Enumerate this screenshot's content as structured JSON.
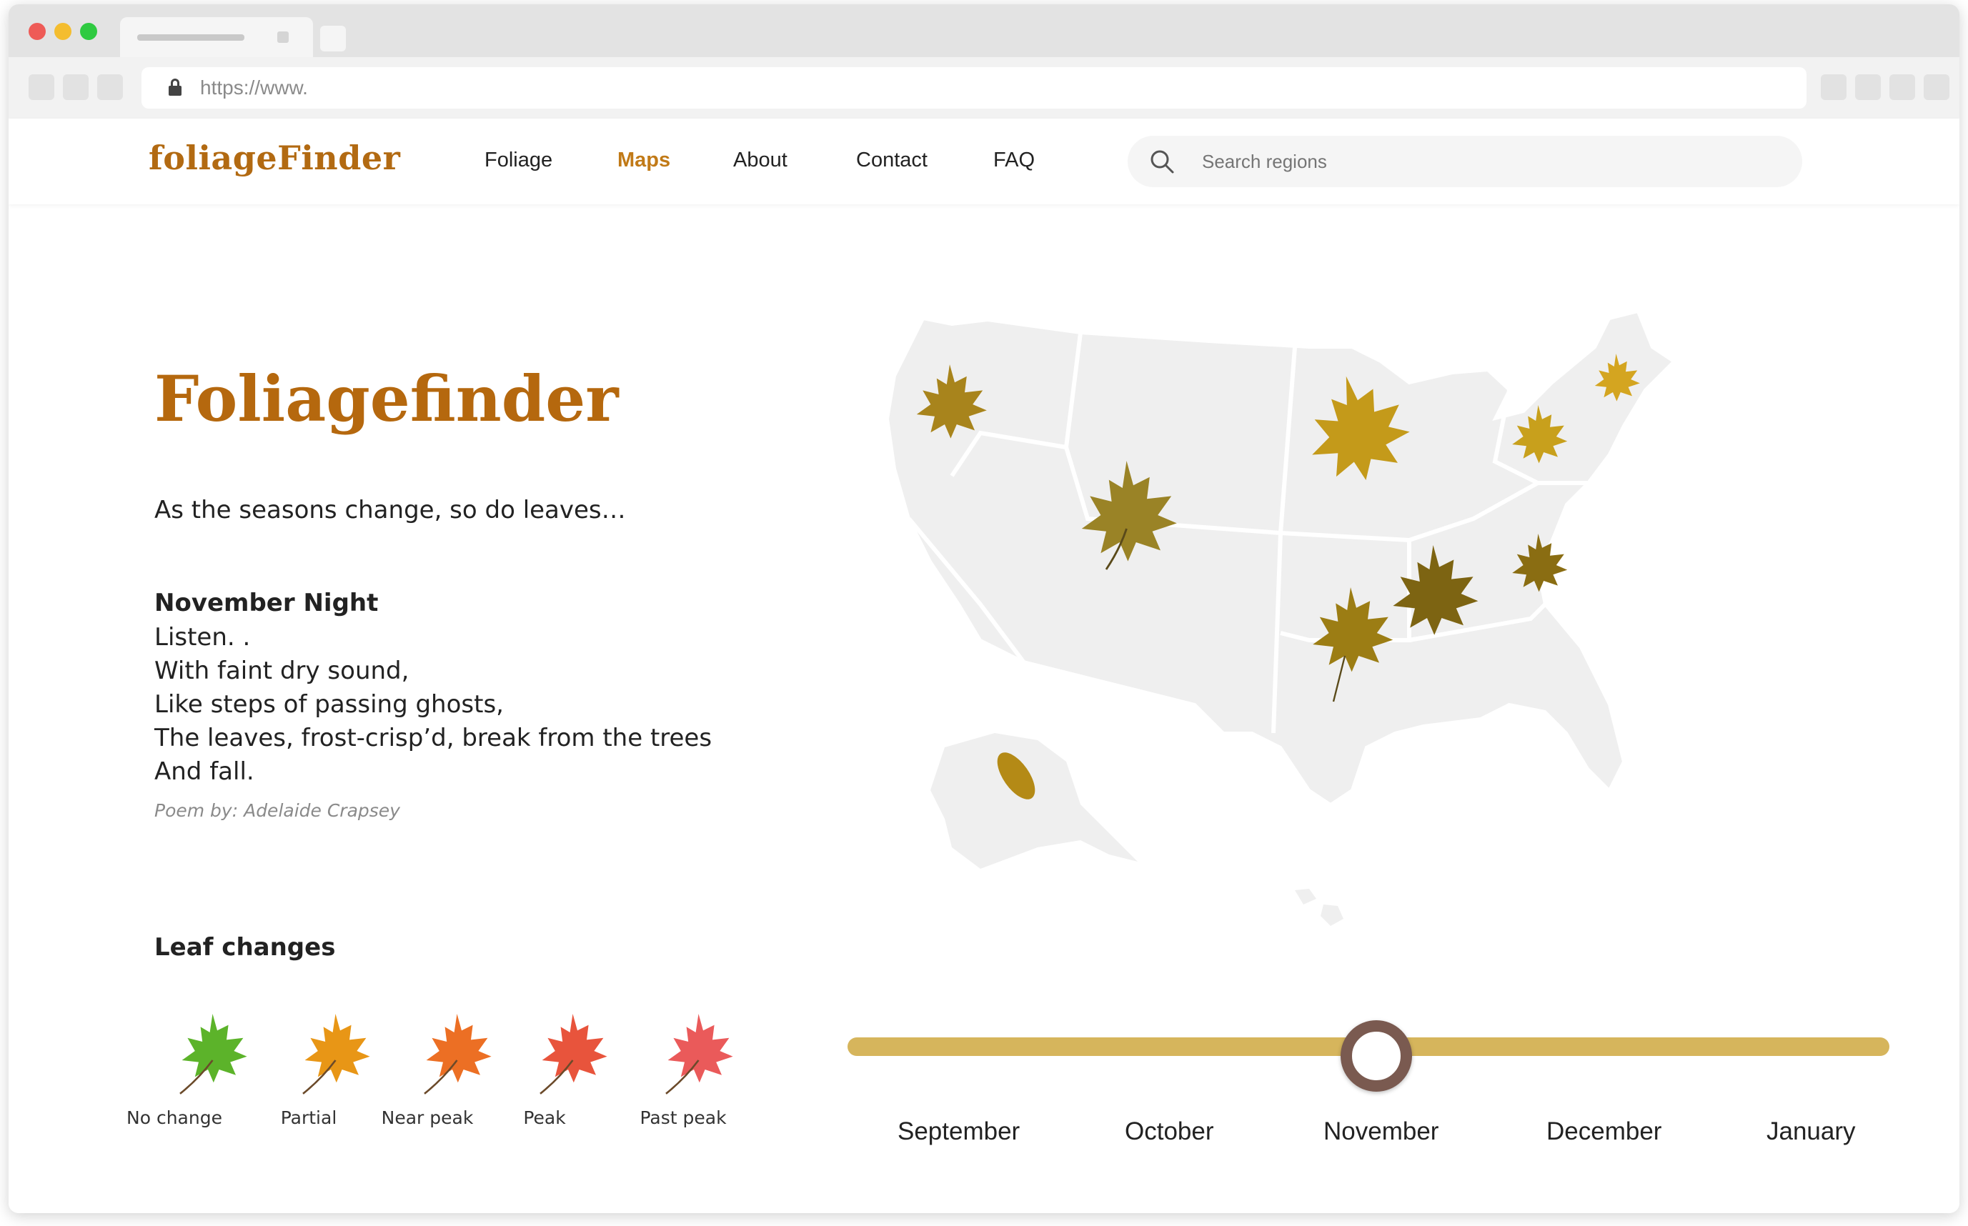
{
  "browser": {
    "url": "https://www."
  },
  "header": {
    "logo": "foliageFinder",
    "nav": [
      "Foliage",
      "Maps",
      "About",
      "Contact",
      "FAQ"
    ],
    "active_nav": "Maps",
    "search_placeholder": "Search regions"
  },
  "hero": {
    "title": "Foliagefinder",
    "tagline": "As the seasons change, so do leaves…"
  },
  "poem": {
    "title": "November Night",
    "lines": [
      "Listen. .",
      "With faint dry sound,",
      "Like steps of passing ghosts,",
      "The leaves, frost-crisp’d, break from the trees",
      "And fall."
    ],
    "author": "Poem by: Adelaide Crapsey"
  },
  "legend": {
    "title": "Leaf changes",
    "items": [
      {
        "label": "No change",
        "color": "#5cb32a"
      },
      {
        "label": "Partial",
        "color": "#e89616"
      },
      {
        "label": "Near peak",
        "color": "#ec6f24"
      },
      {
        "label": "Peak",
        "color": "#e8543c"
      },
      {
        "label": "Past peak",
        "color": "#ea5a5a"
      }
    ]
  },
  "map": {
    "region_color": "#efefef",
    "leaf_colors": [
      "#a8841c",
      "#c49a1a",
      "#8a6d12",
      "#d4a520"
    ]
  },
  "timeline": {
    "months": [
      "September",
      "October",
      "November",
      "December",
      "January"
    ],
    "selected": "November",
    "track_color": "#d6b55c",
    "thumb_color": "#7a5a50"
  },
  "colors": {
    "brand": "#b5680e",
    "nav_active": "#c17a17"
  }
}
